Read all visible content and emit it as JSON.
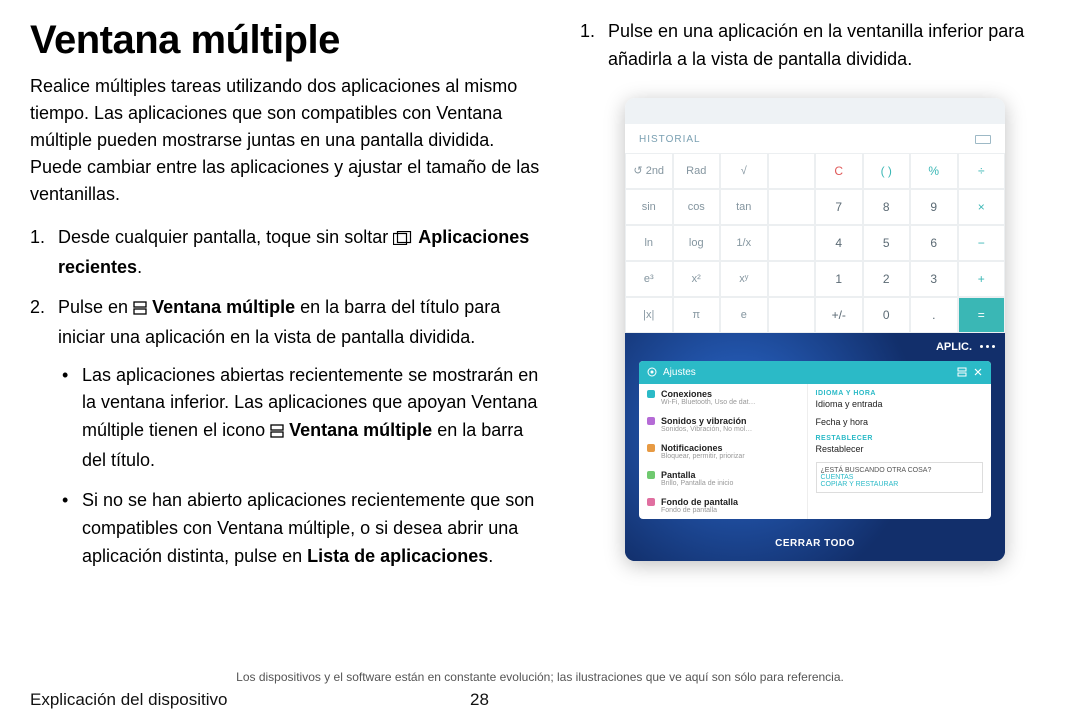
{
  "title": "Ventana múltiple",
  "intro": "Realice múltiples tareas utilizando dos aplicaciones al mismo tiempo. Las aplicaciones que son compatibles con Ventana múltiple pueden mostrarse juntas en una pantalla dividida. Puede cambiar entre las aplicaciones y ajustar el tamaño de las ventanillas.",
  "steps": {
    "s1_pre": "Desde cualquier pantalla, toque sin soltar ",
    "s1_bold": "Aplicaciones recientes",
    "s1_post": ".",
    "s2_pre": "Pulse en ",
    "s2_bold": "Ventana múltiple",
    "s2_post": " en la barra del título para iniciar una aplicación en la vista de pantalla dividida.",
    "s2_b1_pre": "Las aplicaciones abiertas recientemente se mostrarán en la ventana inferior. Las aplicaciones que apoyan Ventana múltiple tienen el icono ",
    "s2_b1_bold": "Ventana múltiple",
    "s2_b1_post": " en la barra del título.",
    "s2_b2_pre": "Si no se han abierto aplicaciones recientemente que son compatibles con Ventana múltiple, o si desea abrir una aplicación distinta, pulse en ",
    "s2_b2_bold": "Lista de aplicaciones",
    "s2_b2_post": ".",
    "s3": "Pulse en una aplicación en la ventanilla inferior para añadirla a la vista de pantalla dividida."
  },
  "device": {
    "historial": "HISTORIAL",
    "calc_rows": [
      [
        "↺ 2nd",
        "Rad",
        "√",
        "C",
        "( )",
        "%",
        "÷"
      ],
      [
        "sin",
        "cos",
        "tan",
        "7",
        "8",
        "9",
        "×"
      ],
      [
        "ln",
        "log",
        "1/x",
        "4",
        "5",
        "6",
        "−"
      ],
      [
        "e³",
        "x²",
        "xʸ",
        "1",
        "2",
        "3",
        "+"
      ],
      [
        "|x|",
        "π",
        "e",
        "+/-",
        "0",
        ".",
        "="
      ]
    ],
    "aplic": "APLIC.",
    "ajustes": {
      "title": "Ajustes",
      "left": [
        {
          "t": "Conexiones",
          "s": "Wi-Fi, Bluetooth, Uso de dat…",
          "c": "#2bbac7"
        },
        {
          "t": "Sonidos y vibración",
          "s": "Sonidos, Vibración, No mol…",
          "c": "#b56bd6"
        },
        {
          "t": "Notificaciones",
          "s": "Bloquear, permitir, priorizar",
          "c": "#e79a43"
        },
        {
          "t": "Pantalla",
          "s": "Brillo, Pantalla de inicio",
          "c": "#6fc96f"
        },
        {
          "t": "Fondo de pantalla",
          "s": "Fondo de pantalla",
          "c": "#e06fa0"
        }
      ],
      "right": {
        "sec1": "IDIOMA Y HORA",
        "l1": "Idioma y entrada",
        "l2": "Fecha y hora",
        "sec2": "RESTABLECER",
        "l3": "Restablecer",
        "box_q": "¿ESTÁ BUSCANDO OTRA COSA?",
        "box_a": "CUENTAS",
        "box_b": "COPIAR Y RESTAURAR"
      }
    },
    "cerrar": "CERRAR TODO"
  },
  "footnote": "Los dispositivos y el software están en constante evolución; las ilustraciones que ve aquí son sólo para referencia.",
  "pager": {
    "section": "Explicación del dispositivo",
    "num": "28"
  }
}
